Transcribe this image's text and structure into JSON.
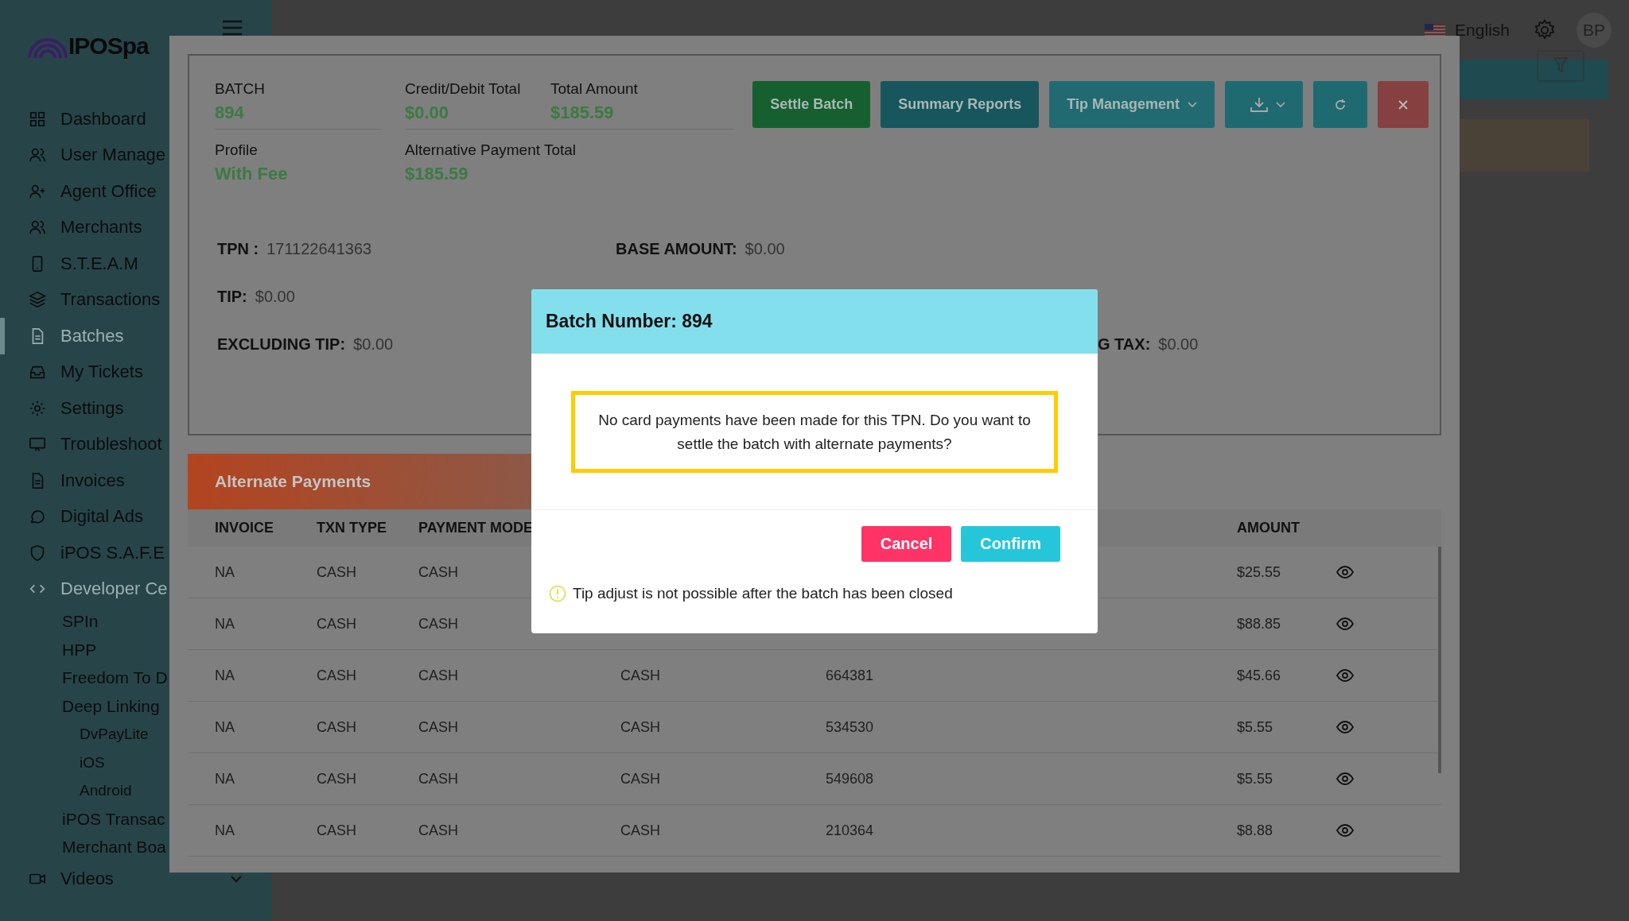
{
  "brand": {
    "logo": "IPOSpa"
  },
  "top_bar": {
    "language": "English",
    "avatar": "BP"
  },
  "sidebar": {
    "items": [
      {
        "label": "Dashboard",
        "selected": false
      },
      {
        "label": "User Manage",
        "selected": false
      },
      {
        "label": "Agent Office",
        "selected": false
      },
      {
        "label": "Merchants",
        "selected": false
      },
      {
        "label": "S.T.E.A.M",
        "selected": false
      },
      {
        "label": "Transactions",
        "selected": false
      },
      {
        "label": "Batches",
        "selected": true
      },
      {
        "label": "My Tickets",
        "selected": false
      },
      {
        "label": "Settings",
        "selected": false
      },
      {
        "label": "Troubleshoot",
        "selected": false
      },
      {
        "label": "Invoices",
        "selected": false
      },
      {
        "label": "Digital Ads",
        "selected": false
      },
      {
        "label": "iPOS S.A.F.E",
        "selected": false
      },
      {
        "label": "Developer Ce",
        "selected": false,
        "expanded": true,
        "children": [
          {
            "label": "SPIn"
          },
          {
            "label": "HPP"
          },
          {
            "label": "Freedom To D"
          },
          {
            "label": "Deep Linking",
            "children": [
              {
                "label": "DvPayLite"
              },
              {
                "label": "iOS"
              },
              {
                "label": "Android"
              }
            ]
          },
          {
            "label": "iPOS Transac"
          },
          {
            "label": "Merchant Boa"
          }
        ]
      },
      {
        "label": "Videos",
        "selected": false,
        "expanded": false
      }
    ]
  },
  "batch_modal": {
    "summary": [
      {
        "label": "BATCH",
        "value": "894"
      },
      {
        "label": "Credit/Debit Total",
        "value": "$0.00"
      },
      {
        "label": "Total Amount",
        "value": "$185.59"
      },
      {
        "label": "Profile",
        "value": "With Fee"
      },
      {
        "label": "Alternative Payment Total",
        "value": "$185.59"
      }
    ],
    "buttons": [
      {
        "kind": "text",
        "label": "Settle Batch"
      },
      {
        "kind": "text",
        "label": "Summary Reports"
      },
      {
        "kind": "dropdown",
        "label": "Tip Management"
      },
      {
        "kind": "download"
      },
      {
        "kind": "refresh"
      },
      {
        "kind": "close"
      }
    ],
    "details": [
      {
        "label": "TPN :",
        "value": "171122641363"
      },
      {
        "label": "BASE AMOUNT:",
        "value": "$0.00"
      },
      {
        "label": "TIP:",
        "value": "$0.00"
      },
      {
        "label": "EXCLUDING TIP:",
        "value": "$0.00"
      },
      {
        "label": "G TAX:",
        "value": "$0.00"
      }
    ],
    "alternate_payments": {
      "title": "Alternate Payments",
      "columns": [
        "INVOICE",
        "TXN TYPE",
        "PAYMENT MODE",
        "AMOUNT"
      ],
      "rows": [
        {
          "invoice": "NA",
          "txn_type": "CASH",
          "payment_mode": "CASH",
          "amount": "$25.55"
        },
        {
          "invoice": "NA",
          "txn_type": "CASH",
          "payment_mode": "CASH",
          "amount": "$88.85"
        },
        {
          "invoice": "NA",
          "txn_type": "CASH",
          "payment_mode": "CASH",
          "column_4": "CASH",
          "column_5": "664381",
          "amount": "$45.66"
        },
        {
          "invoice": "NA",
          "txn_type": "CASH",
          "payment_mode": "CASH",
          "column_4": "CASH",
          "column_5": "534530",
          "amount": "$5.55"
        },
        {
          "invoice": "NA",
          "txn_type": "CASH",
          "payment_mode": "CASH",
          "column_4": "CASH",
          "column_5": "549608",
          "amount": "$5.55"
        },
        {
          "invoice": "NA",
          "txn_type": "CASH",
          "payment_mode": "CASH",
          "column_4": "CASH",
          "column_5": "210364",
          "amount": "$8.88"
        }
      ]
    }
  },
  "confirm_dialog": {
    "title": "Batch Number: 894",
    "message": "No card payments have been made for this TPN. Do you want to settle the batch with alternate payments?",
    "buttons": [
      {
        "kind": "cancel",
        "label": "Cancel"
      },
      {
        "kind": "confirm",
        "label": "Confirm"
      }
    ],
    "note": "Tip adjust is not possible after the batch has been closed"
  }
}
